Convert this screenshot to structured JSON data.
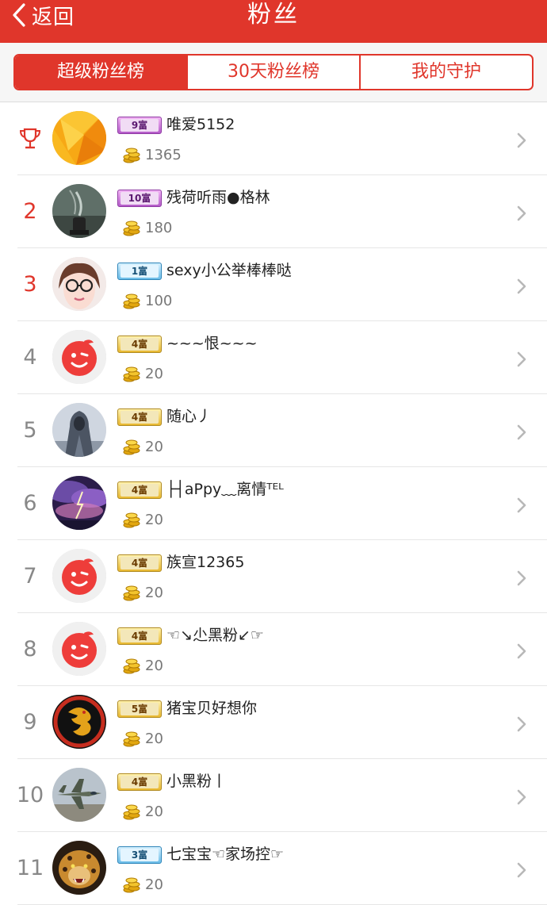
{
  "header": {
    "back_label": "返回",
    "title": "粉丝",
    "background_color": "#e0362b"
  },
  "tabs": [
    {
      "label": "超级粉丝榜",
      "active": true
    },
    {
      "label": "30天粉丝榜",
      "active": false
    },
    {
      "label": "我的守护",
      "active": false
    }
  ],
  "fans": [
    {
      "rank": "",
      "rank_icon": "trophy-icon",
      "avatar": "orange-polygon",
      "badge": "9富",
      "badge_color": "purple",
      "name": "唯爱5152",
      "coins": "1365"
    },
    {
      "rank": "2",
      "avatar": "incense-photo",
      "badge": "10富",
      "badge_color": "purple",
      "name": "残荷听雨●格林",
      "coins": "180"
    },
    {
      "rank": "3",
      "avatar": "girl-glasses-photo",
      "badge": "1富",
      "badge_color": "blue",
      "name": "sexy小公举棒棒哒",
      "coins": "100"
    },
    {
      "rank": "4",
      "avatar": "default-face",
      "badge": "4富",
      "badge_color": "gold",
      "name": "~~~恨~~~",
      "coins": "20"
    },
    {
      "rank": "5",
      "avatar": "hooded-figure",
      "badge": "4富",
      "badge_color": "gold",
      "name": "随心丿",
      "coins": "20"
    },
    {
      "rank": "6",
      "avatar": "storm-sky",
      "badge": "4富",
      "badge_color": "gold",
      "name": "├┤aPpy﹏离情ᵀᴱᴸ",
      "coins": "20"
    },
    {
      "rank": "7",
      "avatar": "default-face",
      "badge": "4富",
      "badge_color": "gold",
      "name": "族宣12365",
      "coins": "20"
    },
    {
      "rank": "8",
      "avatar": "default-face",
      "badge": "4富",
      "badge_color": "gold",
      "name": "☜↘尐黑粉↙☞",
      "coins": "20"
    },
    {
      "rank": "9",
      "avatar": "dragon-logo",
      "badge": "5富",
      "badge_color": "gold",
      "name": "猪宝贝好想你",
      "coins": "20"
    },
    {
      "rank": "10",
      "avatar": "fighter-jet",
      "badge": "4富",
      "badge_color": "gold",
      "name": "小黑粉丨",
      "coins": "20"
    },
    {
      "rank": "11",
      "avatar": "leopard",
      "badge": "3富",
      "badge_color": "blue",
      "name": "七宝宝☜家场控☞",
      "coins": "20"
    }
  ]
}
